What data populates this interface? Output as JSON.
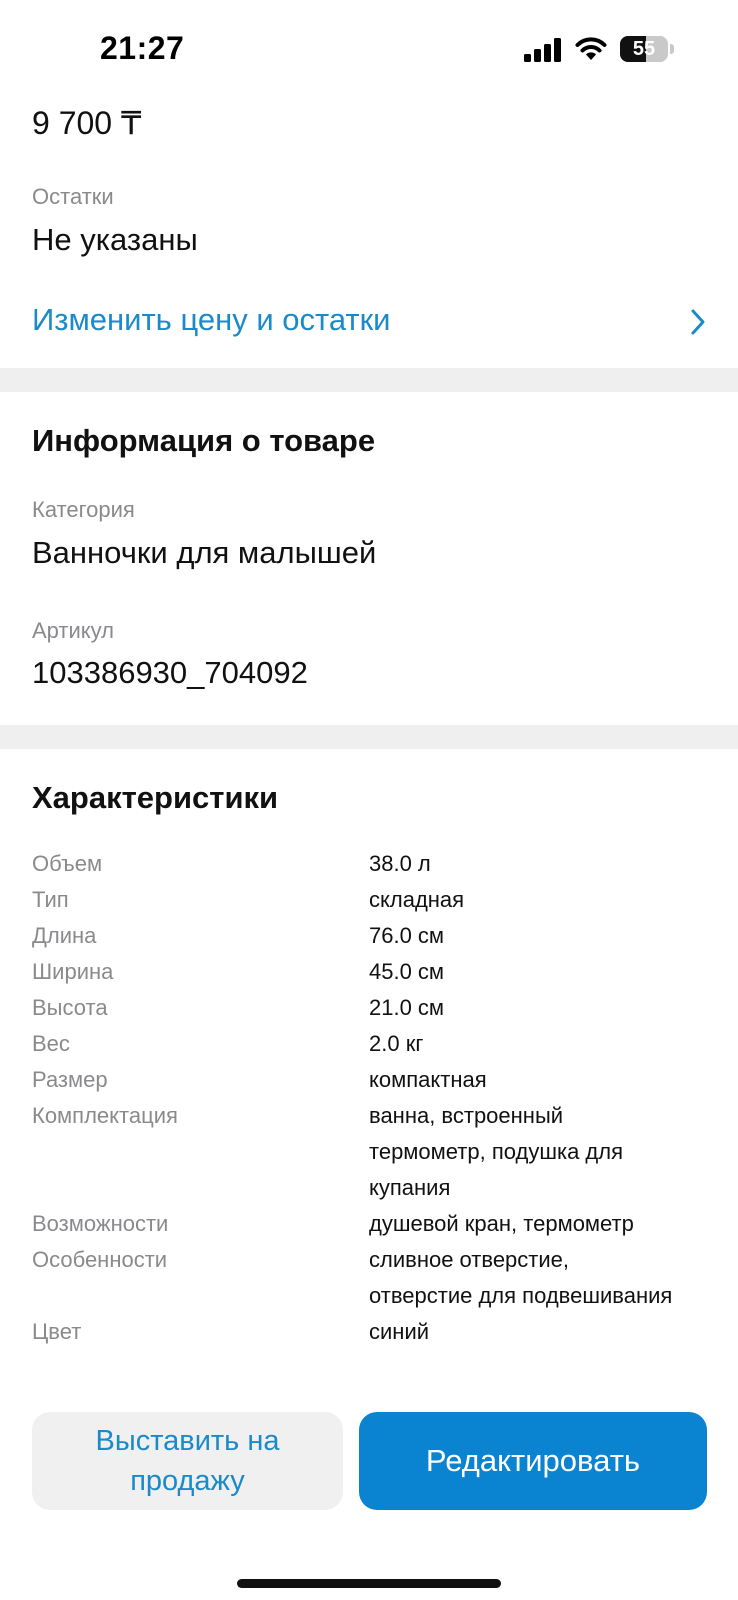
{
  "status_bar": {
    "time": "21:27",
    "battery_level": "55",
    "battery_fraction": 0.55,
    "icons": [
      "signal-icon",
      "wifi-icon",
      "battery-icon"
    ]
  },
  "price": {
    "value": "9 700 ₸"
  },
  "stock": {
    "label": "Остатки",
    "value": "Не указаны"
  },
  "change_link": {
    "label": "Изменить цену и остатки",
    "icon": "chevron-right-icon"
  },
  "product_info": {
    "title": "Информация о товаре",
    "category_label": "Категория",
    "category_value": "Ванночки для малышей",
    "sku_label": "Артикул",
    "sku_value": "103386930_704092"
  },
  "characteristics": {
    "title": "Характеристики",
    "rows": [
      {
        "key": "Объем",
        "value": "38.0 л"
      },
      {
        "key": "Тип",
        "value": "складная"
      },
      {
        "key": "Длина",
        "value": "76.0 см"
      },
      {
        "key": "Ширина",
        "value": "45.0 см"
      },
      {
        "key": "Высота",
        "value": "21.0 см"
      },
      {
        "key": "Вес",
        "value": "2.0 кг"
      },
      {
        "key": "Размер",
        "value": "компактная"
      },
      {
        "key": "Комплектация",
        "value_lines": [
          "ванна, встроенный",
          "термометр, подушка для",
          "купания"
        ]
      },
      {
        "key": "Возможности",
        "value": "душевой кран, термометр"
      },
      {
        "key": "Особенности",
        "value_lines": [
          "сливное отверстие,",
          "отверстие для подвешивания"
        ]
      },
      {
        "key": "Цвет",
        "value": "синий"
      }
    ]
  },
  "actions": {
    "publish_line1": "Выставить на",
    "publish_line2": "продажу",
    "edit_label": "Редактировать"
  },
  "colors": {
    "accent": "#1a8ac9",
    "primary_button": "#0a84d0",
    "secondary_button": "#f0f0f0",
    "label_gray": "#8a8a8e",
    "divider": "#efefef"
  }
}
